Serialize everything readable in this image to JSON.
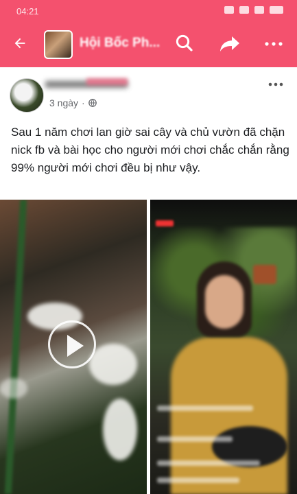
{
  "status_bar": {
    "time": "04:21"
  },
  "app_bar": {
    "group_name": "Hội Bốc Ph...",
    "back_icon": "arrow-left-icon",
    "search_icon": "search-icon",
    "share_icon": "share-icon",
    "more_icon": "more-horizontal-icon",
    "background_color": "#f4516e"
  },
  "post": {
    "time": "3 ngày",
    "separator": "·",
    "privacy_icon": "globe-icon",
    "text": "Sau 1 năm chơi lan giờ sai cây và chủ vườn đã chặn nick fb và bài học cho người mới chơi chắc chắn rằng 99% người mới chơi đều bị như vậy.",
    "media": [
      {
        "type": "video",
        "icon": "play-icon"
      },
      {
        "type": "video-livestream"
      }
    ]
  }
}
